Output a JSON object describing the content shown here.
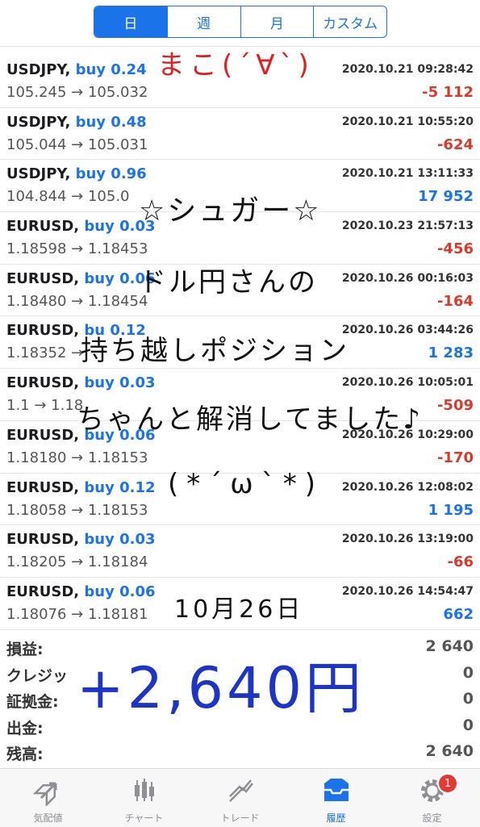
{
  "period_tabs": [
    {
      "label": "日",
      "active": true
    },
    {
      "label": "週",
      "active": false
    },
    {
      "label": "月",
      "active": false
    },
    {
      "label": "カスタム",
      "active": false
    }
  ],
  "trades": [
    {
      "symbol": "USDJPY,",
      "side": "buy 0.24",
      "price": "105.245 → 105.032",
      "time": "2020.10.21 09:28:42",
      "profit": "-5 112",
      "sign": "neg"
    },
    {
      "symbol": "USDJPY,",
      "side": "buy 0.48",
      "price": "105.044 → 105.031",
      "time": "2020.10.21 10:55:20",
      "profit": "-624",
      "sign": "neg"
    },
    {
      "symbol": "USDJPY,",
      "side": "buy 0.96",
      "price": "104.844 → 105.0",
      "time": "2020.10.21 13:11:33",
      "profit": "17 952",
      "sign": "pos"
    },
    {
      "symbol": "EURUSD,",
      "side": "buy 0.03",
      "price": "1.18598 → 1.18453",
      "time": "2020.10.23 21:57:13",
      "profit": "-456",
      "sign": "neg"
    },
    {
      "symbol": "EURUSD,",
      "side": "buy 0.06",
      "price": "1.18480 → 1.18454",
      "time": "2020.10.26 00:16:03",
      "profit": "-164",
      "sign": "neg"
    },
    {
      "symbol": "EURUSD,",
      "side": "bu 0.12",
      "price": "1.18352 →",
      "time": "2020.10.26 03:44:26",
      "profit": "1 283",
      "sign": "pos"
    },
    {
      "symbol": "EURUSD,",
      "side": "buy 0.03",
      "price": "1.1 → 1.18",
      "time": "2020.10.26 10:05:01",
      "profit": "-509",
      "sign": "neg"
    },
    {
      "symbol": "EURUSD,",
      "side": "buy 0.06",
      "price": "1.18180 → 1.18153",
      "time": "2020.10.26 10:29:00",
      "profit": "-170",
      "sign": "neg"
    },
    {
      "symbol": "EURUSD,",
      "side": "buy 0.12",
      "price": "1.18058 → 1.18153",
      "time": "2020.10.26 12:08:02",
      "profit": "1 195",
      "sign": "pos"
    },
    {
      "symbol": "EURUSD,",
      "side": "buy 0.03",
      "price": "1.18205 → 1.18184",
      "time": "2020.10.26 13:19:00",
      "profit": "-66",
      "sign": "neg"
    },
    {
      "symbol": "EURUSD,",
      "side": "buy 0.06",
      "price": "1.18076 → 1.18181",
      "time": "2020.10.26 14:54:47",
      "profit": "662",
      "sign": "pos"
    }
  ],
  "summary": [
    {
      "label": "損益:",
      "value": "2 640"
    },
    {
      "label": "クレジッ",
      "value": "0"
    },
    {
      "label": "証拠金:",
      "value": "0"
    },
    {
      "label": "出金:",
      "value": "0"
    },
    {
      "label": "残高:",
      "value": "2 640"
    }
  ],
  "tabbar": [
    {
      "label": "気配値",
      "icon": "quotes-icon",
      "active": false
    },
    {
      "label": "チャート",
      "icon": "chart-icon",
      "active": false
    },
    {
      "label": "トレード",
      "icon": "trade-icon",
      "active": false
    },
    {
      "label": "履歴",
      "icon": "history-icon",
      "active": true
    },
    {
      "label": "設定",
      "icon": "settings-icon",
      "active": false,
      "badge": "1"
    }
  ],
  "handwriting": {
    "face": "まこ(´∀`)",
    "line1": "☆シュガー☆",
    "line2": "ドル円さんの",
    "line3": "持ち越しポジション",
    "line4": "ちゃんと解消してました♪",
    "line5": "(*´ω`*)",
    "date": "10月26日",
    "total": "+2,640円"
  },
  "colors": {
    "accent": "#1a73e8",
    "negative": "#d93a2b",
    "handwriting_red": "#e02020",
    "handwriting_blue": "#1c35c8"
  }
}
